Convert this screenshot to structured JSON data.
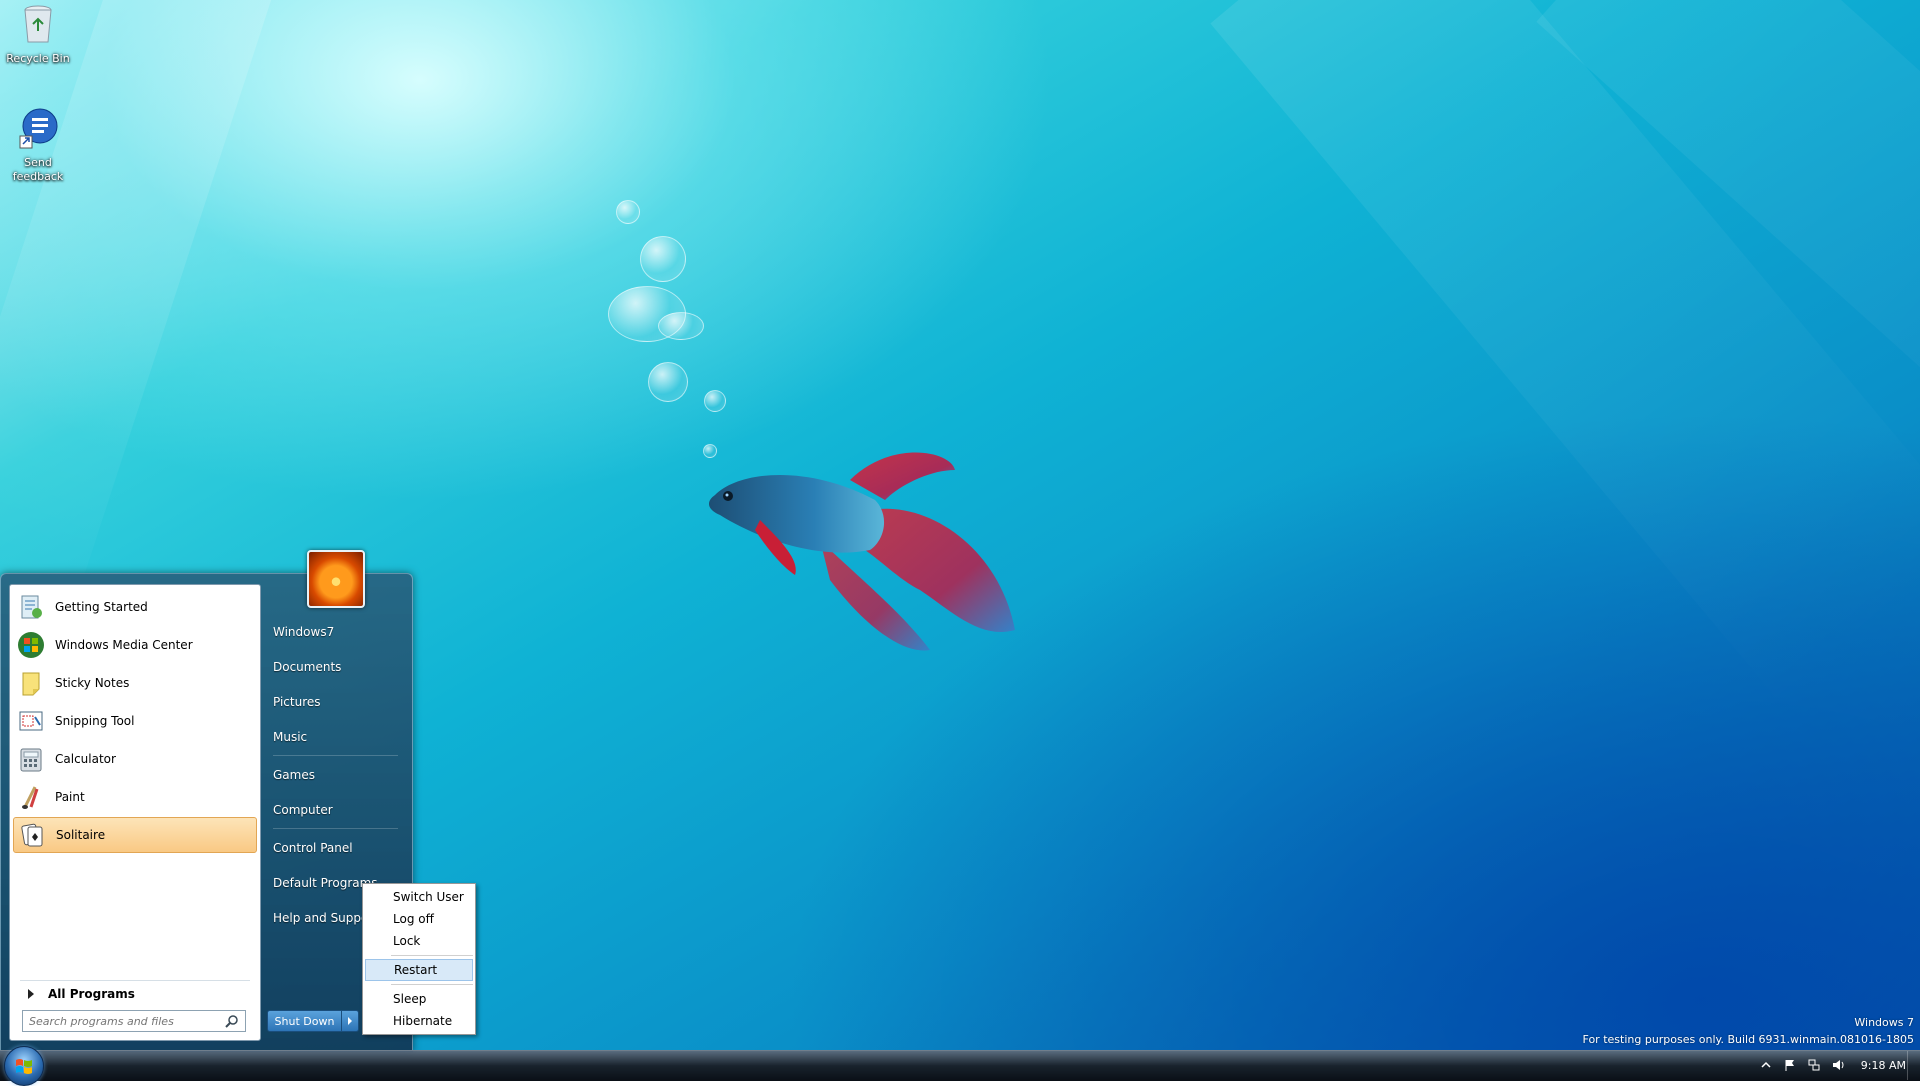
{
  "desktop": {
    "icons": [
      {
        "label": "Recycle Bin",
        "icon": "recycle-bin-icon"
      },
      {
        "label": "Send feedback",
        "icon": "feedback-icon"
      }
    ],
    "watermark_line1": "Windows 7",
    "watermark_line2": "For testing purposes only. Build 6931.winmain.081016-1805"
  },
  "start_menu": {
    "pinned": [
      {
        "label": "Getting Started",
        "icon": "getting-started-icon"
      },
      {
        "label": "Windows Media Center",
        "icon": "media-center-icon"
      },
      {
        "label": "Sticky Notes",
        "icon": "sticky-notes-icon"
      },
      {
        "label": "Snipping Tool",
        "icon": "snipping-tool-icon"
      },
      {
        "label": "Calculator",
        "icon": "calculator-icon"
      },
      {
        "label": "Paint",
        "icon": "paint-icon"
      },
      {
        "label": "Solitaire",
        "icon": "solitaire-icon",
        "highlighted": true
      }
    ],
    "all_programs": "All Programs",
    "search_placeholder": "Search programs and files",
    "right_items": [
      "Windows7",
      "Documents",
      "Pictures",
      "Music",
      "Games",
      "Computer",
      "Control Panel",
      "Default Programs",
      "Help and Support"
    ],
    "shutdown_label": "Shut Down"
  },
  "shutdown_menu": {
    "items": [
      "Switch User",
      "Log off",
      "Lock",
      "Restart",
      "Sleep",
      "Hibernate"
    ],
    "highlighted": "Restart"
  },
  "taskbar": {
    "clock": "9:18 AM",
    "tray_icons": [
      "show-hidden-icons-arrow-icon",
      "action-center-flag-icon",
      "network-icon",
      "volume-icon"
    ]
  },
  "colors": {
    "highlight_orange": "#f9c984",
    "menu_highlight_blue": "#d8e9f8",
    "start_panel": "#285a78"
  }
}
